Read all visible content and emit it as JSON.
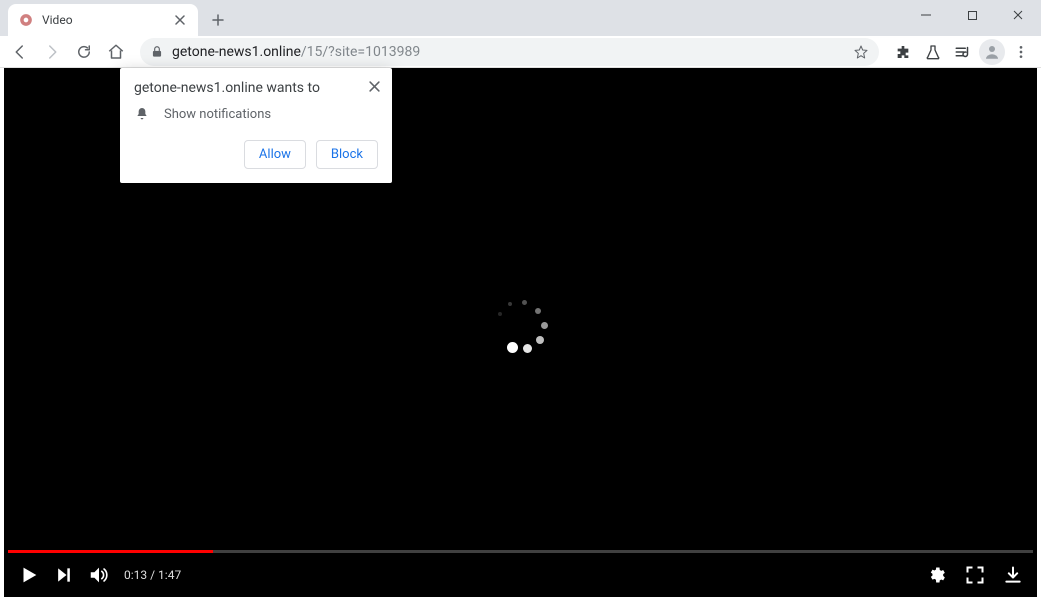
{
  "tab": {
    "title": "Video"
  },
  "url": {
    "domain": "getone-news1.online",
    "path": "/15/?site=1013989"
  },
  "permission": {
    "origin_line": "getone-news1.online wants to",
    "notify_label": "Show notifications",
    "allow_label": "Allow",
    "block_label": "Block"
  },
  "video": {
    "current_time": "0:13",
    "duration": "1:47",
    "time_display": "0:13 / 1:47",
    "progress_percent": 20
  }
}
